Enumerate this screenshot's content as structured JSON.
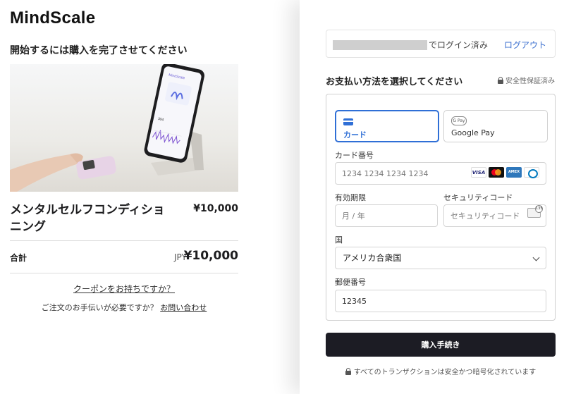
{
  "brand": {
    "logo": "MindScale"
  },
  "left": {
    "heading": "開始するには購入を完了させてください",
    "product": {
      "name": "メンタルセルフコンディショニング",
      "price": "¥10,000"
    },
    "total": {
      "label": "合計",
      "currency": "JPY",
      "amount": "¥10,000"
    },
    "coupon_link": "クーポンをお持ちですか？",
    "help_text": "ご注文のお手伝いが必要ですか？",
    "help_link": "お問い合わせ",
    "hero": {
      "app_title": "MindScale",
      "app_value": "304"
    }
  },
  "right": {
    "login": {
      "status": "でログイン済み",
      "logout": "ログアウト"
    },
    "payment_title": "お支払い方法を選択してください",
    "secure_badge": "安全性保証済み",
    "methods": [
      {
        "label": "カード"
      },
      {
        "label": "Google Pay",
        "glyph": "G Pay"
      }
    ],
    "card_number": {
      "label": "カード番号",
      "placeholder": "1234 1234 1234 1234"
    },
    "card_brands": [
      "VISA",
      "",
      "AMEX",
      ""
    ],
    "expiry": {
      "label": "有効期限",
      "placeholder": "月 / 年"
    },
    "cvc": {
      "label": "セキュリティコード",
      "placeholder": "セキュリティコード",
      "icon_text": "135"
    },
    "country": {
      "label": "国",
      "value": "アメリカ合衆国"
    },
    "postal": {
      "label": "郵便番号",
      "value": "12345"
    },
    "buy_button": "購入手続き",
    "footer_note": "すべてのトランザクションは安全かつ暗号化されています"
  }
}
